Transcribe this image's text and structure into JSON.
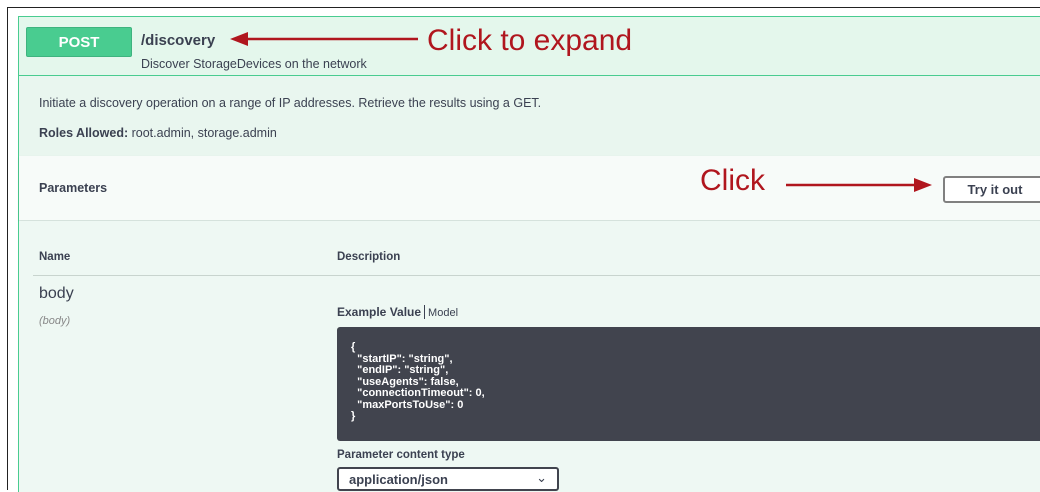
{
  "operation": {
    "method": "POST",
    "path": "/discovery",
    "summary": "Discover StorageDevices on the network",
    "description": "Initiate a discovery operation on a range of IP addresses. Retrieve the results using a GET.",
    "roles_label": "Roles Allowed:",
    "roles_value": " root.admin, storage.admin"
  },
  "parameters": {
    "title": "Parameters",
    "try_label": "Try it out",
    "col_name": "Name",
    "col_description": "Description",
    "param_name": "body",
    "param_in": "(body)",
    "example_tab": "Example Value",
    "model_tab": "Model",
    "example_code": "{\n  \"startIP\": \"string\",\n  \"endIP\": \"string\",\n  \"useAgents\": false,\n  \"connectionTimeout\": 0,\n  \"maxPortsToUse\": 0\n}",
    "content_type_label": "Parameter content type",
    "content_type_value": "application/json"
  },
  "annotations": {
    "expand": "Click to expand",
    "click": "Click",
    "color": "#b0161e"
  },
  "colors": {
    "post_green": "#49cc90",
    "code_bg": "#41444e"
  }
}
